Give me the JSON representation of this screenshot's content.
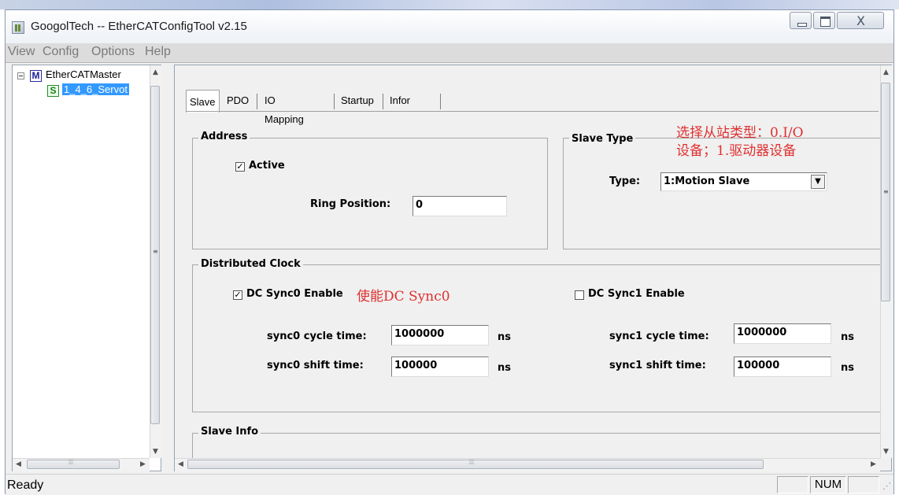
{
  "window": {
    "title": "GoogolTech -- EtherCATConfigTool v2.15",
    "close_glyph": "X"
  },
  "menubar": {
    "items": [
      "View",
      "Config",
      "Options",
      "Help"
    ]
  },
  "tree": {
    "root_icon_letter": "M",
    "root_label": "EtherCATMaster",
    "child_icon_letter": "S",
    "child_label": "1_4_6_Servot"
  },
  "tabs": [
    "Slave",
    "PDO",
    "IO Mapping",
    "Startup",
    "Infor"
  ],
  "address": {
    "title": "Address",
    "active_label": "Active",
    "active_checked": true,
    "ring_position_label": "Ring Position:",
    "ring_position_value": "0"
  },
  "slave_type": {
    "title": "Slave Type",
    "type_label": "Type:",
    "type_value": "1:Motion Slave",
    "annotation_line1": "选择从站类型：0.I/O",
    "annotation_line2": "设备；1.驱动器设备"
  },
  "distributed_clock": {
    "title": "Distributed Clock",
    "sync0_enable_label": "DC Sync0 Enable",
    "sync0_enable_checked": true,
    "sync0_annotation": "使能DC Sync0",
    "sync1_enable_label": "DC Sync1 Enable",
    "sync1_enable_checked": false,
    "sync0_cycle_label": "sync0 cycle time:",
    "sync0_cycle_value": "1000000",
    "sync0_shift_label": "sync0 shift time:",
    "sync0_shift_value": "100000",
    "sync1_cycle_label": "sync1 cycle time:",
    "sync1_cycle_value": "1000000",
    "sync1_shift_label": "sync1 shift time:",
    "sync1_shift_value": "100000",
    "unit": "ns"
  },
  "slave_info": {
    "title": "Slave Info"
  },
  "statusbar": {
    "text": "Ready",
    "num_indicator": "NUM"
  }
}
